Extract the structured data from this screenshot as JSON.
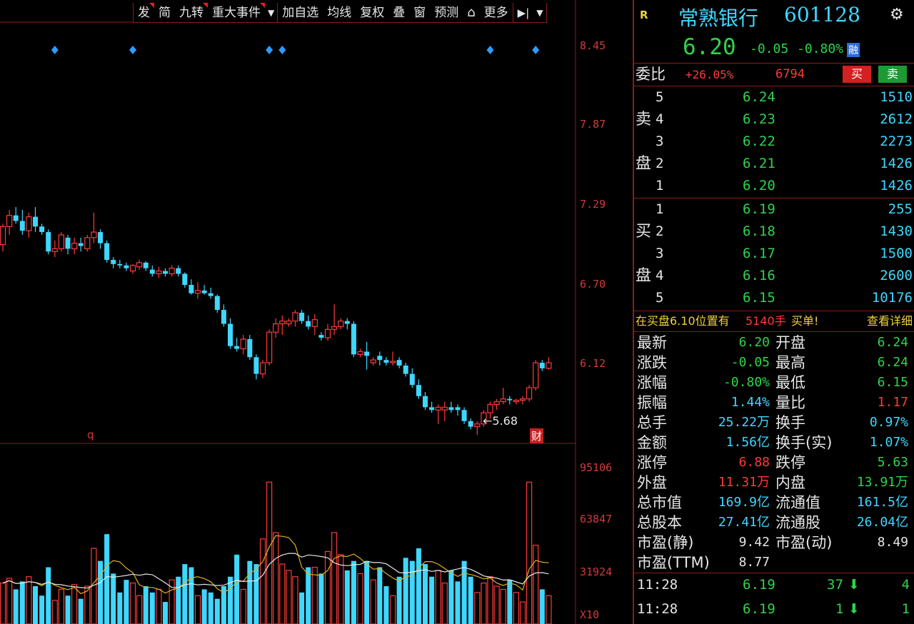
{
  "toolbar": {
    "items": [
      "发",
      "简",
      "九转",
      "重大事件",
      "加自选",
      "均线",
      "复权",
      "叠",
      "窗",
      "预测",
      "锁",
      "更多"
    ]
  },
  "price_axis": [
    "8.45",
    "7.87",
    "7.29",
    "6.70",
    "6.12"
  ],
  "volume_axis": [
    "95106",
    "63847",
    "31924",
    "X10"
  ],
  "chart_labels": {
    "low_marker": "5.68",
    "bottom_left": "q",
    "finance_tag": "财"
  },
  "colors": {
    "up": "#ff3a3a",
    "down": "#3fd7ff",
    "ma_white": "#e6e6e6",
    "ma_yellow": "#e0b020",
    "grid": "#8a1c1c",
    "marker": "#2f9bff"
  },
  "chart_data": {
    "type": "candlestick",
    "y_axis_ticks": [
      8.45,
      7.87,
      7.29,
      6.7,
      6.12
    ],
    "ylim": [
      5.62,
      8.45
    ],
    "marked_low": 5.68,
    "candles": [
      [
        7.05,
        7.2,
        7.0,
        7.18
      ],
      [
        7.18,
        7.3,
        7.12,
        7.26
      ],
      [
        7.26,
        7.32,
        7.2,
        7.22
      ],
      [
        7.22,
        7.3,
        7.12,
        7.15
      ],
      [
        7.15,
        7.28,
        7.1,
        7.25
      ],
      [
        7.25,
        7.32,
        7.14,
        7.18
      ],
      [
        7.18,
        7.2,
        7.12,
        7.14
      ],
      [
        7.14,
        7.16,
        6.98,
        7.0
      ],
      [
        7.0,
        7.08,
        6.96,
        7.02
      ],
      [
        7.02,
        7.14,
        7.0,
        7.12
      ],
      [
        7.1,
        7.12,
        6.98,
        7.02
      ],
      [
        7.02,
        7.1,
        6.98,
        7.06
      ],
      [
        7.06,
        7.1,
        7.0,
        7.04
      ],
      [
        7.02,
        7.12,
        7.0,
        7.1
      ],
      [
        7.1,
        7.28,
        7.06,
        7.14
      ],
      [
        7.14,
        7.16,
        7.02,
        7.06
      ],
      [
        7.06,
        7.08,
        6.92,
        6.94
      ],
      [
        6.94,
        6.96,
        6.88,
        6.91
      ],
      [
        6.91,
        6.94,
        6.88,
        6.9
      ],
      [
        6.9,
        6.92,
        6.86,
        6.88
      ],
      [
        6.86,
        6.91,
        6.84,
        6.9
      ],
      [
        6.89,
        6.94,
        6.87,
        6.92
      ],
      [
        6.92,
        6.93,
        6.86,
        6.88
      ],
      [
        6.87,
        6.9,
        6.82,
        6.84
      ],
      [
        6.84,
        6.89,
        6.81,
        6.86
      ],
      [
        6.86,
        6.88,
        6.82,
        6.84
      ],
      [
        6.84,
        6.9,
        6.82,
        6.88
      ],
      [
        6.88,
        6.9,
        6.82,
        6.84
      ],
      [
        6.84,
        6.85,
        6.74,
        6.76
      ],
      [
        6.76,
        6.8,
        6.69,
        6.7
      ],
      [
        6.7,
        6.78,
        6.66,
        6.72
      ],
      [
        6.72,
        6.76,
        6.69,
        6.7
      ],
      [
        6.7,
        6.74,
        6.66,
        6.68
      ],
      [
        6.68,
        6.69,
        6.56,
        6.58
      ],
      [
        6.58,
        6.62,
        6.46,
        6.48
      ],
      [
        6.48,
        6.52,
        6.3,
        6.32
      ],
      [
        6.32,
        6.38,
        6.28,
        6.3
      ],
      [
        6.3,
        6.4,
        6.26,
        6.37
      ],
      [
        6.37,
        6.4,
        6.22,
        6.24
      ],
      [
        6.24,
        6.26,
        6.08,
        6.12
      ],
      [
        6.12,
        6.22,
        6.09,
        6.2
      ],
      [
        6.2,
        6.44,
        6.18,
        6.42
      ],
      [
        6.42,
        6.52,
        6.38,
        6.48
      ],
      [
        6.48,
        6.54,
        6.4,
        6.5
      ],
      [
        6.48,
        6.52,
        6.46,
        6.5
      ],
      [
        6.5,
        6.58,
        6.46,
        6.56
      ],
      [
        6.56,
        6.58,
        6.48,
        6.5
      ],
      [
        6.5,
        6.54,
        6.44,
        6.46
      ],
      [
        6.46,
        6.55,
        6.4,
        6.51
      ],
      [
        6.4,
        6.42,
        6.36,
        6.38
      ],
      [
        6.38,
        6.48,
        6.36,
        6.44
      ],
      [
        6.44,
        6.62,
        6.4,
        6.46
      ],
      [
        6.46,
        6.52,
        6.44,
        6.5
      ],
      [
        6.5,
        6.52,
        6.44,
        6.48
      ],
      [
        6.48,
        6.5,
        6.24,
        6.26
      ],
      [
        6.26,
        6.3,
        6.24,
        6.28
      ],
      [
        6.28,
        6.35,
        6.15,
        6.25
      ],
      [
        6.2,
        6.24,
        6.18,
        6.22
      ],
      [
        6.25,
        6.28,
        6.18,
        6.22
      ],
      [
        6.22,
        6.24,
        6.18,
        6.2
      ],
      [
        6.2,
        6.28,
        6.18,
        6.21
      ],
      [
        6.22,
        6.24,
        6.16,
        6.18
      ],
      [
        6.18,
        6.2,
        6.1,
        6.12
      ],
      [
        6.12,
        6.16,
        6.02,
        6.04
      ],
      [
        6.04,
        6.08,
        5.94,
        5.96
      ],
      [
        5.96,
        5.99,
        5.86,
        5.88
      ],
      [
        5.88,
        5.92,
        5.84,
        5.86
      ],
      [
        5.86,
        5.9,
        5.76,
        5.88
      ],
      [
        5.86,
        5.92,
        5.78,
        5.88
      ],
      [
        5.88,
        5.92,
        5.84,
        5.86
      ],
      [
        5.88,
        5.9,
        5.82,
        5.86
      ],
      [
        5.86,
        5.88,
        5.76,
        5.78
      ],
      [
        5.78,
        5.8,
        5.72,
        5.74
      ],
      [
        5.74,
        5.78,
        5.68,
        5.76
      ],
      [
        5.76,
        5.86,
        5.74,
        5.84
      ],
      [
        5.84,
        5.92,
        5.8,
        5.9
      ],
      [
        5.9,
        5.94,
        5.86,
        5.92
      ],
      [
        5.92,
        6.02,
        5.9,
        5.94
      ],
      [
        5.94,
        5.96,
        5.9,
        5.93
      ],
      [
        5.92,
        5.94,
        5.9,
        5.93
      ],
      [
        5.93,
        5.96,
        5.9,
        5.94
      ],
      [
        5.94,
        6.04,
        5.92,
        6.02
      ],
      [
        6.02,
        6.22,
        6.0,
        6.2
      ],
      [
        6.2,
        6.22,
        6.14,
        6.16
      ],
      [
        6.16,
        6.24,
        6.15,
        6.2
      ]
    ],
    "volume": [
      26000,
      29000,
      22000,
      27000,
      30000,
      24000,
      18000,
      36000,
      15000,
      22000,
      18000,
      25000,
      16000,
      24000,
      48000,
      40000,
      57000,
      32000,
      20000,
      28000,
      26000,
      18000,
      24000,
      20000,
      22000,
      14000,
      28000,
      30000,
      38000,
      36000,
      18000,
      22000,
      20000,
      16000,
      24000,
      30000,
      44000,
      22000,
      40000,
      38000,
      54000,
      90000,
      58000,
      38000,
      34000,
      30000,
      20000,
      36000,
      36000,
      32000,
      46000,
      58000,
      44000,
      34000,
      40000,
      32000,
      40000,
      28000,
      36000,
      24000,
      18000,
      30000,
      42000,
      40000,
      48000,
      38000,
      30000,
      34000,
      26000,
      34000,
      27000,
      40000,
      30000,
      20000,
      26000,
      30000,
      24000,
      22000,
      28000,
      20000,
      14000,
      90000,
      50000,
      22000,
      18000
    ],
    "markers": [
      {
        "label": "◆",
        "value": 8.45
      }
    ]
  },
  "quote": {
    "flag": "R",
    "name": "常熟银行",
    "code": "601128",
    "price": "6.20",
    "change": "-0.05",
    "change_pct": "-0.80%",
    "tag": "融",
    "weibi_label": "委比",
    "weibi_value": "+26.05%",
    "weicha_value": "6794",
    "buy_btn": "买",
    "sell_btn": "卖"
  },
  "order_book": {
    "sell_labels": [
      "卖",
      "盘"
    ],
    "buy_labels": [
      "买",
      "盘"
    ],
    "sell": [
      {
        "level": "5",
        "price": "6.24",
        "vol": "1510"
      },
      {
        "level": "4",
        "price": "6.23",
        "vol": "2612"
      },
      {
        "level": "3",
        "price": "6.22",
        "vol": "2273"
      },
      {
        "level": "2",
        "price": "6.21",
        "vol": "1426"
      },
      {
        "level": "1",
        "price": "6.20",
        "vol": "1426"
      }
    ],
    "buy": [
      {
        "level": "1",
        "price": "6.19",
        "vol": "255"
      },
      {
        "level": "2",
        "price": "6.18",
        "vol": "1430"
      },
      {
        "level": "3",
        "price": "6.17",
        "vol": "1500"
      },
      {
        "level": "4",
        "price": "6.16",
        "vol": "2600"
      },
      {
        "level": "5",
        "price": "6.15",
        "vol": "10176"
      }
    ]
  },
  "notice": {
    "text_a": "在买盘6.10位置有",
    "text_b": "5140手",
    "text_c": "买单!",
    "link": "查看详细"
  },
  "stats": [
    {
      "l1": "最新",
      "v1": "6.20",
      "c1": "g",
      "l2": "开盘",
      "v2": "6.24",
      "c2": "g"
    },
    {
      "l1": "涨跌",
      "v1": "-0.05",
      "c1": "g",
      "l2": "最高",
      "v2": "6.24",
      "c2": "g"
    },
    {
      "l1": "涨幅",
      "v1": "-0.80%",
      "c1": "g",
      "l2": "最低",
      "v2": "6.15",
      "c2": "g"
    },
    {
      "l1": "振幅",
      "v1": "1.44%",
      "c1": "c",
      "l2": "量比",
      "v2": "1.17",
      "c2": "r"
    },
    {
      "l1": "总手",
      "v1": "25.22万",
      "c1": "c",
      "l2": "换手",
      "v2": "0.97%",
      "c2": "c"
    },
    {
      "l1": "金额",
      "v1": "1.56亿",
      "c1": "c",
      "l2": "换手(实)",
      "v2": "1.07%",
      "c2": "c"
    },
    {
      "l1": "涨停",
      "v1": "6.88",
      "c1": "r",
      "l2": "跌停",
      "v2": "5.63",
      "c2": "g"
    },
    {
      "l1": "外盘",
      "v1": "11.31万",
      "c1": "r",
      "l2": "内盘",
      "v2": "13.91万",
      "c2": "g"
    },
    {
      "l1": "总市值",
      "v1": "169.9亿",
      "c1": "c",
      "l2": "流通值",
      "v2": "161.5亿",
      "c2": "c"
    },
    {
      "l1": "总股本",
      "v1": "27.41亿",
      "c1": "c",
      "l2": "流通股",
      "v2": "26.04亿",
      "c2": "c"
    },
    {
      "l1": "市盈(静)",
      "v1": "9.42",
      "c1": "w",
      "l2": "市盈(动)",
      "v2": "8.49",
      "c2": "w"
    },
    {
      "l1": "市盈(TTM)",
      "v1": "8.77",
      "c1": "w",
      "l2": "",
      "v2": "",
      "c2": "w"
    }
  ],
  "ticks": [
    {
      "time": "11:28",
      "price": "6.19",
      "vol": "37",
      "count": "4"
    },
    {
      "time": "11:28",
      "price": "6.19",
      "vol": "1",
      "count": "1"
    }
  ]
}
